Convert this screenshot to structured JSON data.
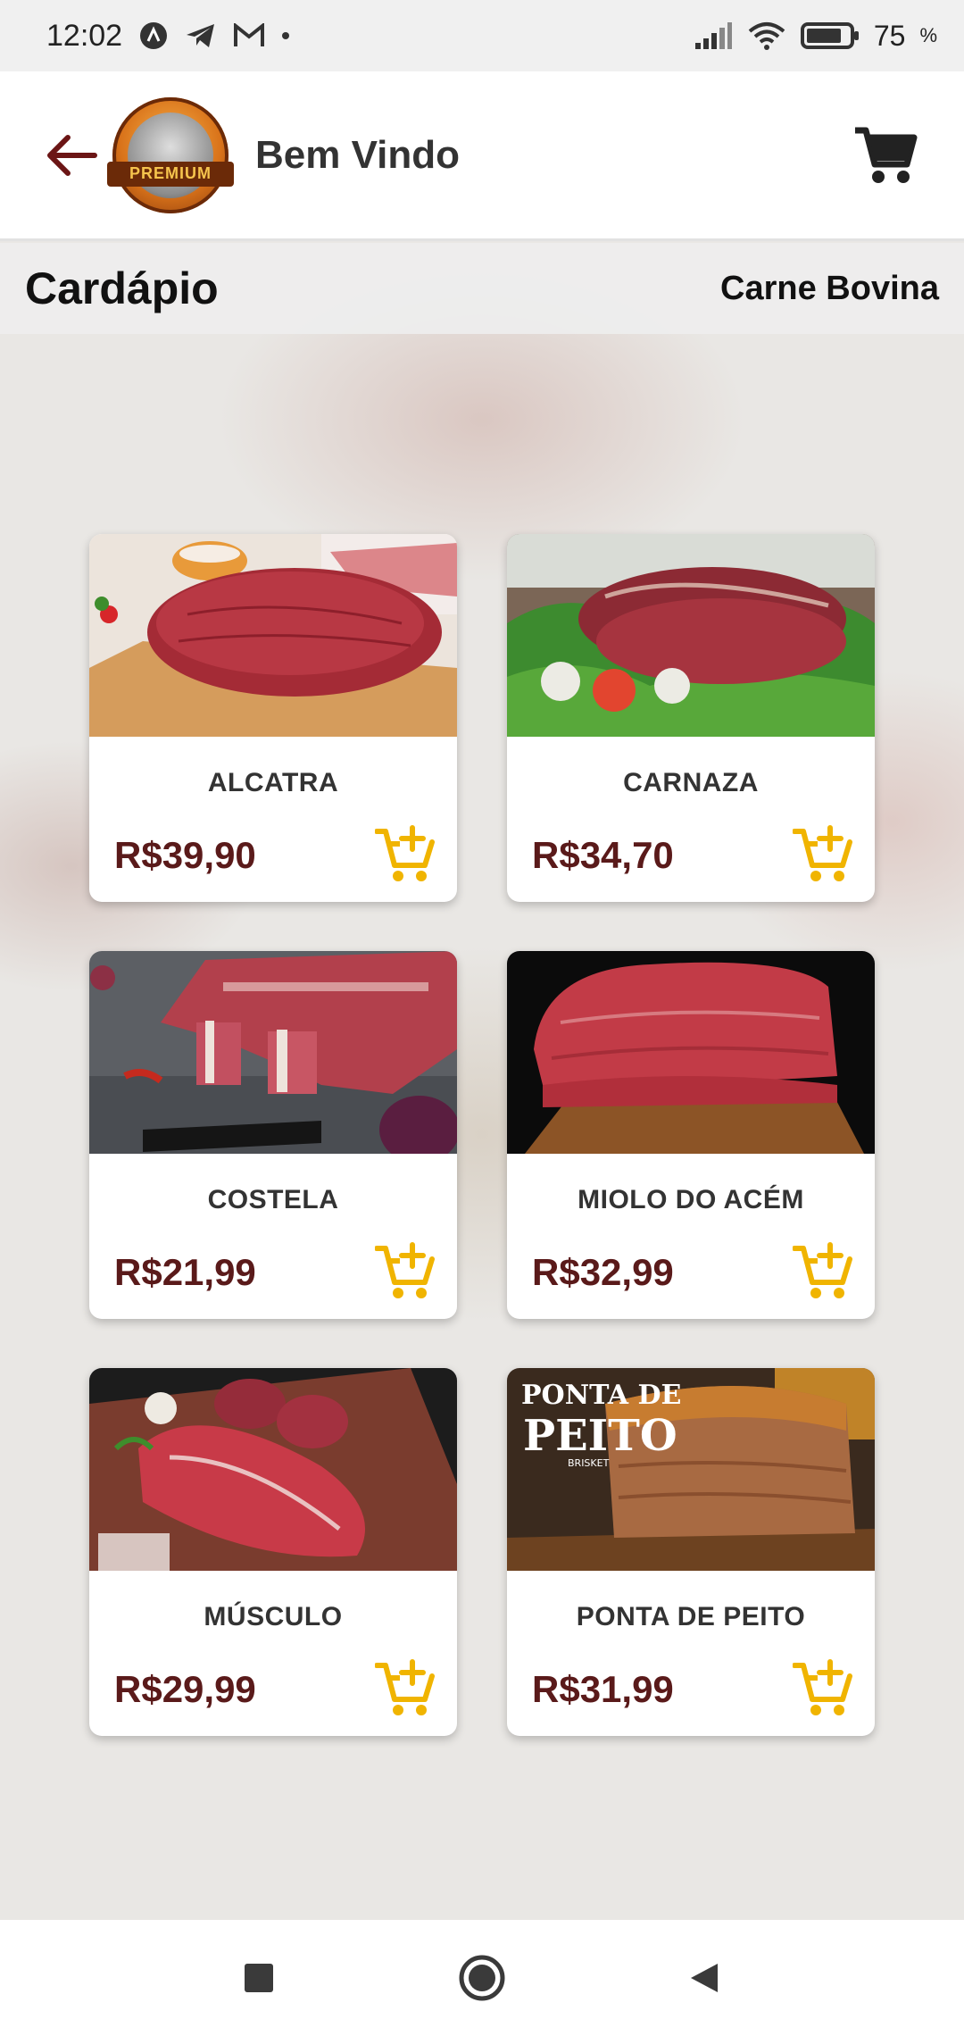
{
  "status_bar": {
    "time": "12:02",
    "battery": "75",
    "battery_unit": "%"
  },
  "header": {
    "title": "Bem Vindo",
    "logo_text": "PREMIUM"
  },
  "section": {
    "title": "Cardápio",
    "category": "Carne Bovina"
  },
  "products": [
    {
      "name": "ALCATRA",
      "price": "R$39,90"
    },
    {
      "name": "CARNAZA",
      "price": "R$34,70"
    },
    {
      "name": "COSTELA",
      "price": "R$21,99"
    },
    {
      "name": "MIOLO DO ACÉM",
      "price": "R$32,99"
    },
    {
      "name": "MÚSCULO",
      "price": "R$29,99"
    },
    {
      "name": "PONTA DE PEITO",
      "price": "R$31,99"
    }
  ],
  "image_text": {
    "ponta_line1": "PONTA DE",
    "ponta_line2": "PEITO",
    "ponta_line3": "BRISKET"
  },
  "colors": {
    "accent": "#f0b400",
    "price": "#5a1a1a",
    "back_arrow": "#6b1515"
  },
  "icons": [
    "back-arrow-icon",
    "cart-icon",
    "add-to-cart-icon",
    "wifi-icon",
    "signal-icon",
    "battery-icon"
  ]
}
